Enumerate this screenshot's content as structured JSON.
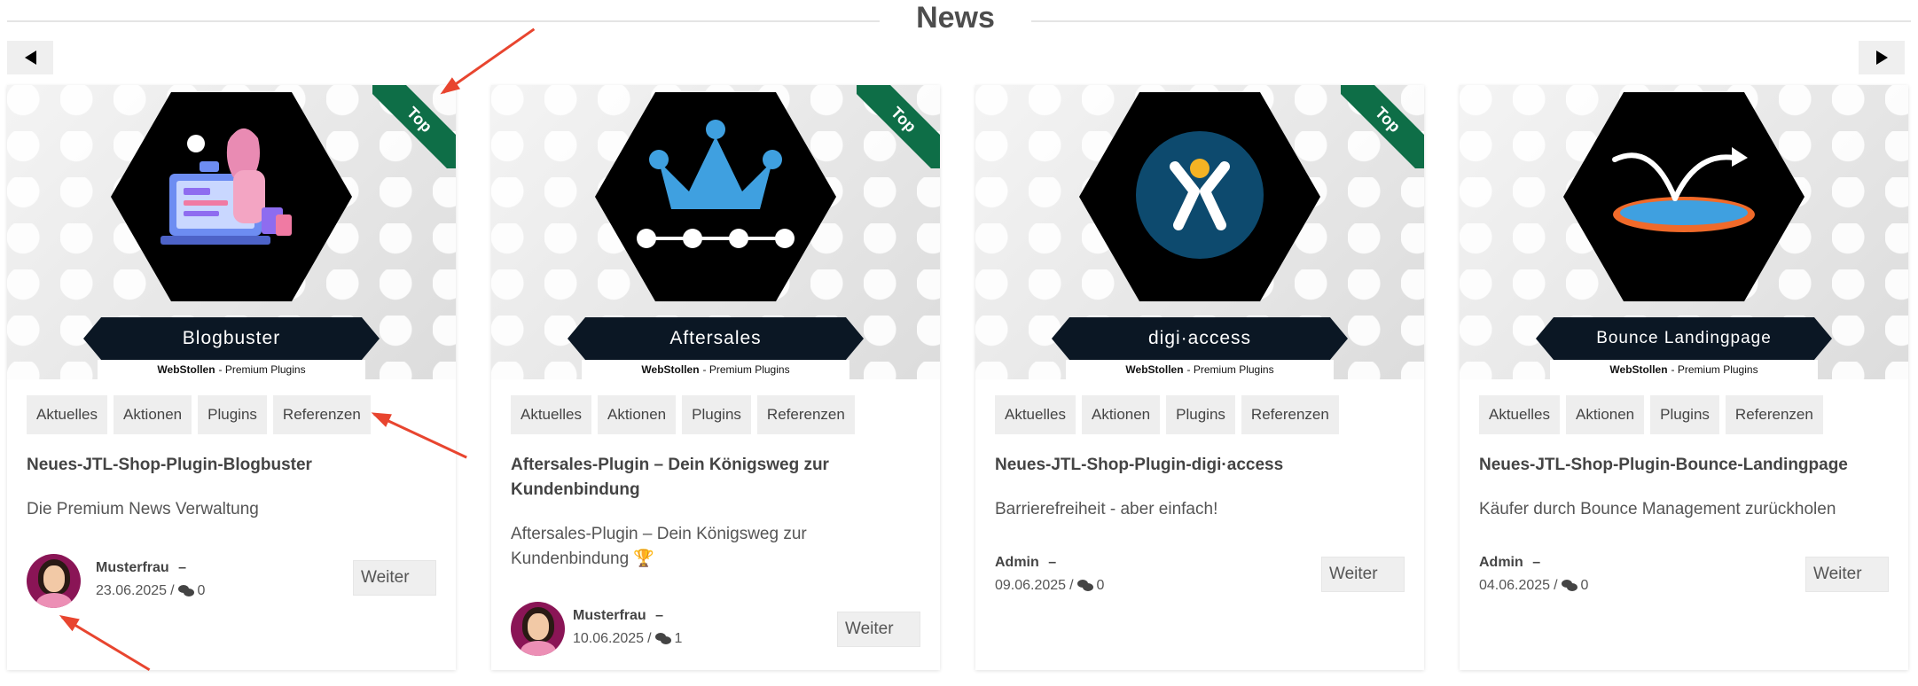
{
  "section": {
    "title": "News"
  },
  "nav": {
    "prev_icon": "triangle-left-icon",
    "next_icon": "triangle-right-icon"
  },
  "colors": {
    "ribbon": "#0e6e47",
    "annotation_arrow": "#e8452f",
    "banner": "#0b1724"
  },
  "cards": [
    {
      "image_title": "Blogbuster",
      "brand_bold": "WebStollen",
      "brand_rest": "- Premium Plugins",
      "ribbon": "Top",
      "tags": [
        "Aktuelles",
        "Aktionen",
        "Plugins",
        "Referenzen"
      ],
      "title": "Neues-JTL-Shop-Plugin-Blogbuster",
      "description": "Die Premium News Verwaltung",
      "author": "Musterfrau",
      "author_sep": "–",
      "date": "23.06.2025",
      "comments": "0",
      "button": "Weiter"
    },
    {
      "image_title": "Aftersales",
      "brand_bold": "WebStollen",
      "brand_rest": "- Premium Plugins",
      "ribbon": "Top",
      "tags": [
        "Aktuelles",
        "Aktionen",
        "Plugins",
        "Referenzen"
      ],
      "title": "Aftersales-Plugin – Dein Königsweg zur Kundenbindung",
      "description": "Aftersales-Plugin – Dein Königsweg zur Kundenbindung 🏆",
      "author": "Musterfrau",
      "author_sep": "–",
      "date": "10.06.2025",
      "comments": "1",
      "button": "Weiter"
    },
    {
      "image_title": "digi·access",
      "brand_bold": "WebStollen",
      "brand_rest": "- Premium Plugins",
      "ribbon": "Top",
      "tags": [
        "Aktuelles",
        "Aktionen",
        "Plugins",
        "Referenzen"
      ],
      "title": "Neues-JTL-Shop-Plugin-digi·access",
      "description": "Barrierefreiheit - aber einfach!",
      "author": "Admin",
      "author_sep": "–",
      "date": "09.06.2025",
      "comments": "0",
      "button": "Weiter"
    },
    {
      "image_title": "Bounce Landingpage",
      "brand_bold": "WebStollen",
      "brand_rest": "- Premium Plugins",
      "tags": [
        "Aktuelles",
        "Aktionen",
        "Plugins",
        "Referenzen"
      ],
      "title": "Neues-JTL-Shop-Plugin-Bounce-Landingpage",
      "description": "Käufer durch Bounce Management zurückholen",
      "author": "Admin",
      "author_sep": "–",
      "date": "04.06.2025",
      "comments": "0",
      "button": "Weiter"
    }
  ]
}
